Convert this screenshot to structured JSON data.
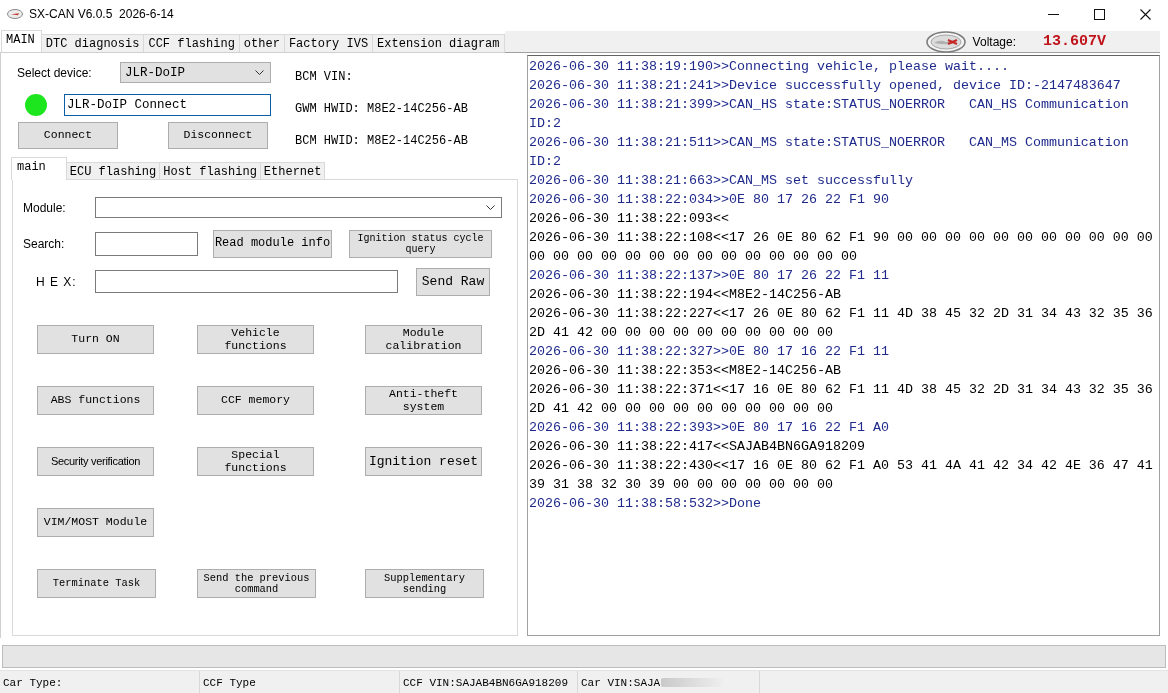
{
  "window": {
    "title": "SX-CAN V6.0.5  2026-6-14"
  },
  "tabs": [
    {
      "label": "MAIN",
      "selected": true
    },
    {
      "label": "DTC diagnosis",
      "selected": false
    },
    {
      "label": "CCF flashing",
      "selected": false
    },
    {
      "label": "other",
      "selected": false
    },
    {
      "label": "Factory IVS",
      "selected": false
    },
    {
      "label": "Extension diagram",
      "selected": false
    }
  ],
  "voltage": {
    "label": "Voltage:",
    "value": "13.607V"
  },
  "device": {
    "label": "Select device:",
    "value": "JLR-DoIP",
    "connected": true,
    "connection_field": {
      "value": "JLR-DoIP Connect",
      "focused": true
    },
    "buttons": [
      "Connect",
      "Disconnect"
    ]
  },
  "vehicle_info": [
    "BCM VIN:",
    "GWM HWID: M8E2-14C256-AB",
    "BCM HWID: M8E2-14C256-AB"
  ],
  "sub_tabs": [
    {
      "label": "main",
      "selected": true
    },
    {
      "label": "ECU flashing",
      "selected": false
    },
    {
      "label": "Host flashing",
      "selected": false
    },
    {
      "label": "Ethernet",
      "selected": false
    }
  ],
  "main_panel": {
    "module": {
      "label": "Module:"
    },
    "search": {
      "label": "Search:",
      "buttons": [
        "Read module info",
        "Ignition status cycle query"
      ]
    },
    "hex": {
      "label": "H E X:",
      "button": "Send Raw"
    },
    "function_buttons": [
      [
        "Turn ON",
        "Vehicle functions",
        "Module calibration"
      ],
      [
        "ABS functions",
        "CCF memory",
        "Anti-theft system"
      ],
      [
        "Security verification",
        "Special functions",
        "Ignition reset"
      ],
      [
        "VIM/MOST Module"
      ],
      [
        "Terminate Task",
        "Send the previous command",
        "Supplementary sending"
      ]
    ]
  },
  "log": [
    {
      "kind": "sent",
      "text": "2026-06-30 11:38:19:190>>Connecting vehicle, please wait...."
    },
    {
      "kind": "sent",
      "text": "2026-06-30 11:38:21:241>>Device successfully opened, device ID:-2147483647"
    },
    {
      "kind": "sent",
      "text": "2026-06-30 11:38:21:399>>CAN_HS state:STATUS_NOERROR   CAN_HS Communication ID:2"
    },
    {
      "kind": "sent",
      "text": "2026-06-30 11:38:21:511>>CAN_MS state:STATUS_NOERROR   CAN_MS Communication ID:2"
    },
    {
      "kind": "sent",
      "text": "2026-06-30 11:38:21:663>>CAN_MS set successfully"
    },
    {
      "kind": "sent",
      "text": "2026-06-30 11:38:22:034>>0E 80 17 26 22 F1 90"
    },
    {
      "kind": "received",
      "text": "2026-06-30 11:38:22:093<<"
    },
    {
      "kind": "received",
      "text": "2026-06-30 11:38:22:108<<17 26 0E 80 62 F1 90 00 00 00 00 00 00 00 00 00 00 00 00 00 00 00 00 00 00 00 00 00 00 00 00 00"
    },
    {
      "kind": "sent",
      "text": "2026-06-30 11:38:22:137>>0E 80 17 26 22 F1 11"
    },
    {
      "kind": "received",
      "text": "2026-06-30 11:38:22:194<<M8E2-14C256-AB"
    },
    {
      "kind": "received",
      "text": "2026-06-30 11:38:22:227<<17 26 0E 80 62 F1 11 4D 38 45 32 2D 31 34 43 32 35 36 2D 41 42 00 00 00 00 00 00 00 00 00 00"
    },
    {
      "kind": "sent",
      "text": "2026-06-30 11:38:22:327>>0E 80 17 16 22 F1 11"
    },
    {
      "kind": "received",
      "text": "2026-06-30 11:38:22:353<<M8E2-14C256-AB"
    },
    {
      "kind": "received",
      "text": "2026-06-30 11:38:22:371<<17 16 0E 80 62 F1 11 4D 38 45 32 2D 31 34 43 32 35 36 2D 41 42 00 00 00 00 00 00 00 00 00 00"
    },
    {
      "kind": "sent",
      "text": "2026-06-30 11:38:22:393>>0E 80 17 16 22 F1 A0"
    },
    {
      "kind": "received",
      "text": "2026-06-30 11:38:22:417<<SAJAB4BN6GA918209"
    },
    {
      "kind": "received",
      "text": "2026-06-30 11:38:22:430<<17 16 0E 80 62 F1 A0 53 41 4A 41 42 34 42 4E 36 47 41 39 31 38 32 30 39 00 00 00 00 00 00 00"
    },
    {
      "kind": "sent",
      "text": "2026-06-30 11:38:58:532>>Done"
    }
  ],
  "progress": {
    "level": 0
  },
  "status_bar": [
    "Car Type:",
    "CCF Type",
    "CCF VIN:SAJAB4BN6GA918209",
    "Car VIN:SAJA"
  ]
}
